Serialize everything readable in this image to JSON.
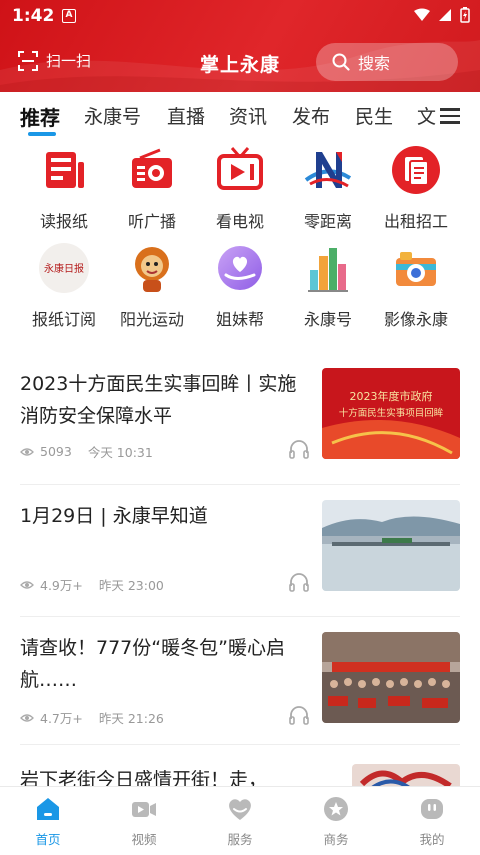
{
  "status_bar": {
    "time": "1:42",
    "notification_badge": "A"
  },
  "header": {
    "scan_label": "扫一扫",
    "title": "掌上永康",
    "search_placeholder": "搜索"
  },
  "tabs": [
    {
      "label": "推荐",
      "active": true
    },
    {
      "label": "永康号"
    },
    {
      "label": "直播"
    },
    {
      "label": "资讯"
    },
    {
      "label": "发布"
    },
    {
      "label": "民生"
    },
    {
      "label": "文"
    }
  ],
  "shortcuts": [
    {
      "label": "读报纸",
      "icon": "newspaper-icon"
    },
    {
      "label": "听广播",
      "icon": "radio-icon"
    },
    {
      "label": "看电视",
      "icon": "tv-icon"
    },
    {
      "label": "零距离",
      "icon": "n-logo-icon"
    },
    {
      "label": "出租招工",
      "icon": "document-icon"
    },
    {
      "label": "报纸订阅",
      "icon": "newspaper-logo-icon",
      "logo_text": "永康日报"
    },
    {
      "label": "阳光运动",
      "icon": "mascot-icon"
    },
    {
      "label": "姐妹帮",
      "icon": "heart-hand-icon"
    },
    {
      "label": "永康号",
      "icon": "city-buildings-icon"
    },
    {
      "label": "影像永康",
      "icon": "camera-icon"
    }
  ],
  "news": [
    {
      "title": "2023十方面民生实事回眸丨实施消防安全保障水平",
      "views": "5093",
      "time": "今天 10:31",
      "thumb_text": [
        "2023年度市政府",
        "十方面民生实事项目回眸"
      ]
    },
    {
      "title": "1月29日 | 永康早知道",
      "views": "4.9万+",
      "time": "昨天 23:00"
    },
    {
      "title": "请查收！777份“暖冬包”暖心启航……",
      "views": "4.7万+",
      "time": "昨天 21:26"
    },
    {
      "title": "岩下老街今日盛情开街！走，"
    }
  ],
  "bottom_nav": [
    {
      "label": "首页",
      "icon": "home-icon",
      "active": true
    },
    {
      "label": "视频",
      "icon": "video-icon"
    },
    {
      "label": "服务",
      "icon": "heart-icon"
    },
    {
      "label": "商务",
      "icon": "star-badge-icon"
    },
    {
      "label": "我的",
      "icon": "profile-icon"
    }
  ],
  "colors": {
    "brand_red": "#d91b1f",
    "accent_blue": "#1a97e6"
  }
}
